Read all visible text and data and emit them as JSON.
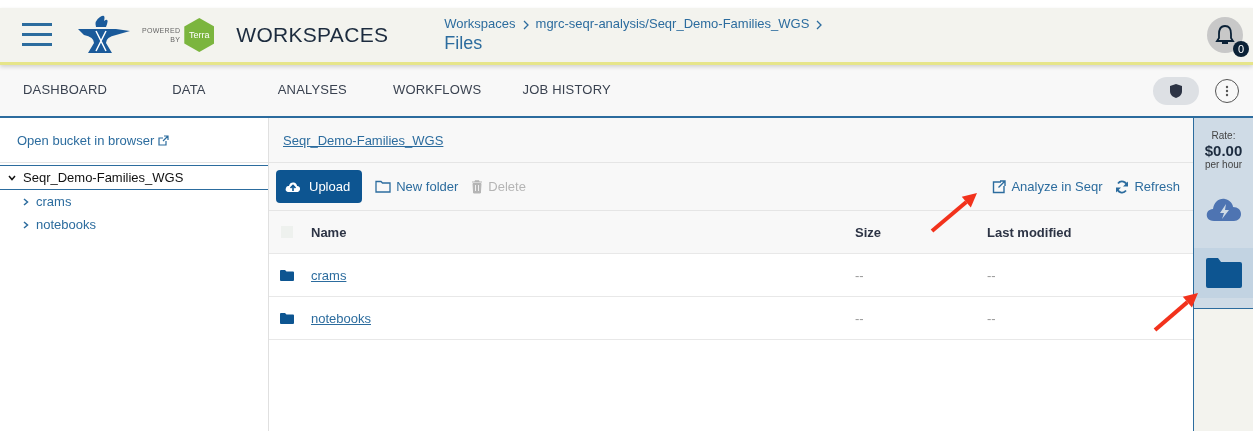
{
  "header": {
    "powered_by": [
      "POWERED",
      "BY"
    ],
    "badge": "Terra",
    "title": "WORKSPACES",
    "breadcrumb": [
      "Workspaces",
      "mgrc-seqr-analysis/Seqr_Demo-Families_WGS"
    ],
    "page": "Files",
    "notifications": "0"
  },
  "tabs": [
    {
      "label": "DASHBOARD",
      "selected": false
    },
    {
      "label": "DATA",
      "selected": false
    },
    {
      "label": "ANALYSES",
      "selected": false
    },
    {
      "label": "WORKFLOWS",
      "selected": false
    },
    {
      "label": "JOB HISTORY",
      "selected": false
    }
  ],
  "sidebar": {
    "link": "Open bucket in browser",
    "tree": [
      {
        "label": "Seqr_Demo-Families_WGS",
        "expanded": true,
        "selected": true,
        "children": [
          {
            "label": "crams",
            "expanded": false,
            "selected": false
          },
          {
            "label": "notebooks",
            "expanded": false,
            "selected": false
          }
        ]
      }
    ]
  },
  "path": "Seqr_Demo-Families_WGS",
  "toolbar": [
    {
      "label": "Upload",
      "kind": "upload",
      "disabled": false
    },
    {
      "label": "New folder",
      "kind": "folder",
      "disabled": false
    },
    {
      "label": "Delete",
      "kind": "delete",
      "disabled": true
    },
    {
      "label": "Analyze in Seqr",
      "kind": "external",
      "disabled": false
    },
    {
      "label": "Refresh",
      "kind": "refresh",
      "disabled": false
    }
  ],
  "table": {
    "select_all": {
      "checked": false
    },
    "columns": [
      "Name",
      "Size",
      "Last modified"
    ],
    "rows": [
      {
        "name": "crams",
        "size": "--",
        "modified": "--"
      },
      {
        "name": "notebooks",
        "size": "--",
        "modified": "--"
      }
    ]
  },
  "rate": {
    "label": "Rate:",
    "value": "$0.00",
    "unit": "per hour"
  },
  "side_tools": [
    {
      "kind": "cloud",
      "selected": false
    },
    {
      "kind": "files",
      "selected": true
    }
  ]
}
